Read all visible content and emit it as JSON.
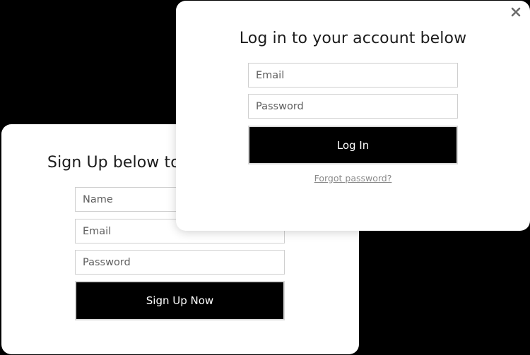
{
  "signup": {
    "title": "Sign Up below to l",
    "name_placeholder": "Name",
    "email_placeholder": "Email",
    "password_placeholder": "Password",
    "submit_label": "Sign Up Now"
  },
  "login": {
    "title": "Log in to your account below",
    "email_placeholder": "Email",
    "password_placeholder": "Password",
    "submit_label": "Log In",
    "forgot_link": "Forgot password?",
    "close_icon": "close-icon"
  },
  "colors": {
    "background": "#000000",
    "card": "#ffffff",
    "button": "#000000",
    "button_text": "#ffffff",
    "link": "#8a8a8a"
  }
}
